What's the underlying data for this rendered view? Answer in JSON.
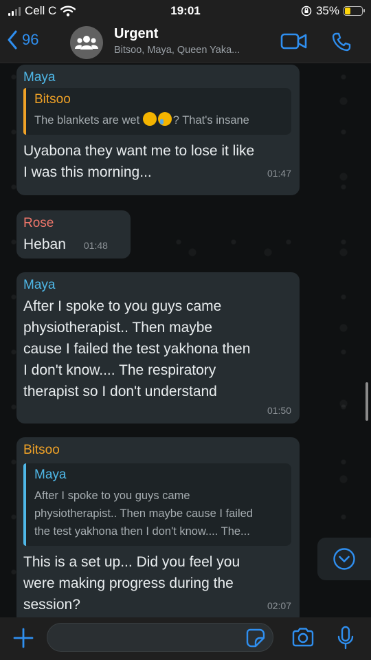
{
  "status_bar": {
    "carrier": "Cell C",
    "time": "19:01",
    "battery_percent": "35%",
    "battery_level": 0.35,
    "icons": [
      "signal-icon",
      "wifi-icon",
      "orientation-lock-icon",
      "battery-icon"
    ]
  },
  "header": {
    "back_count": "96",
    "title": "Urgent",
    "members": "Bitsoo, Maya, Queen Yaka...",
    "icons": [
      "back-chevron-icon",
      "group-avatar-icon",
      "video-call-icon",
      "phone-call-icon"
    ],
    "accent_color": "#2f8ff0"
  },
  "messages": [
    {
      "sender": "Maya",
      "sender_color": "#4fb8e8",
      "quote": {
        "author": "Bitsoo",
        "author_color": "#f0a227",
        "text_before": "The blankets are wet",
        "emojis": [
          "weary-face-emoji",
          "loudly-crying-face-emoji"
        ],
        "text_after": "? That's insane"
      },
      "text_line1": "Uyabona they want me to lose it like",
      "text_line2": "I was this morning...",
      "time": "01:47"
    },
    {
      "sender": "Rose",
      "sender_color": "#f0776b",
      "text": "Heban",
      "time": "01:48"
    },
    {
      "sender": "Maya",
      "sender_color": "#4fb8e8",
      "lines": [
        "After I spoke to you guys came",
        "physiotherapist.. Then maybe",
        "cause I failed the test yakhona then",
        "I don't know.... The respiratory",
        "therapist so I don't understand"
      ],
      "time": "01:50"
    },
    {
      "sender": "Bitsoo",
      "sender_color": "#f0a227",
      "quote": {
        "author": "Maya",
        "author_color": "#4fb8e8",
        "lines": [
          "After I spoke to you guys came",
          "physiotherapist.. Then maybe cause I failed",
          "the test yakhona then I don't know.... The..."
        ]
      },
      "lines": [
        "This is a set up... Did you feel you",
        "were making progress during the",
        "session?"
      ],
      "time": "02:07"
    }
  ],
  "input_bar": {
    "placeholder": "",
    "icons": [
      "plus-icon",
      "sticker-icon",
      "camera-icon",
      "microphone-icon"
    ]
  },
  "scroll_down_icon": "chevron-down-circle-icon"
}
